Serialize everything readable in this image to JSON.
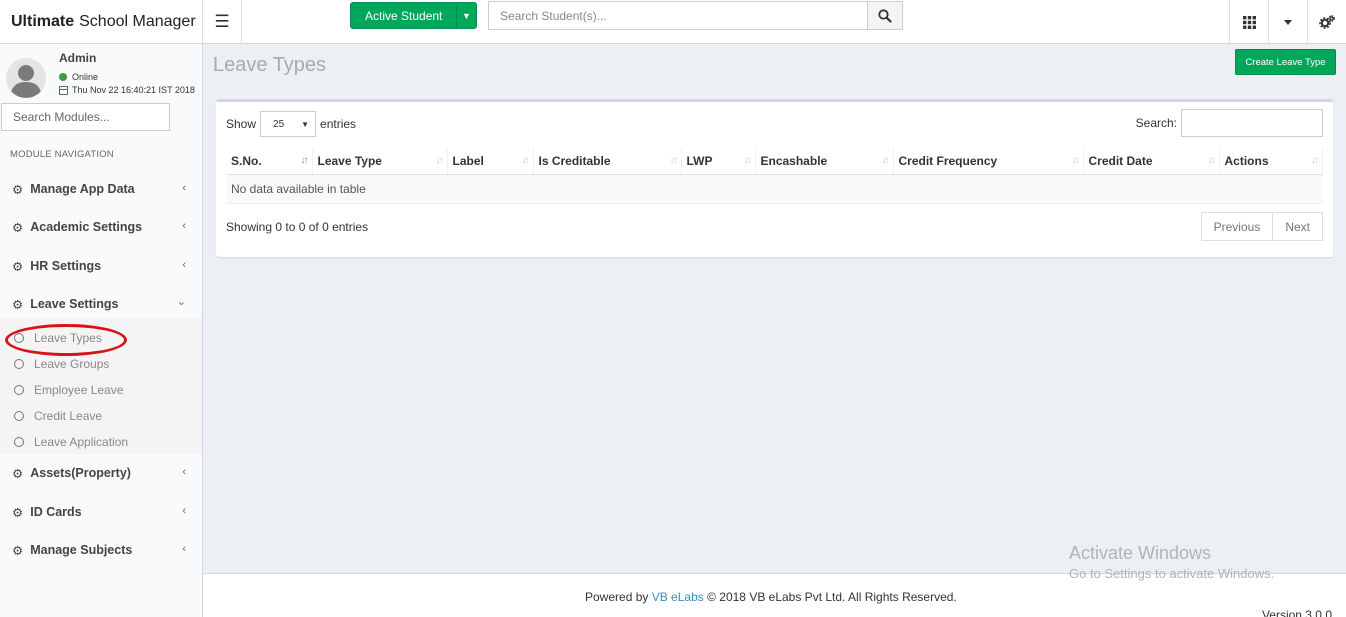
{
  "app": {
    "title_bold": "Ultimate",
    "title_rest": "School Manager"
  },
  "topbar": {
    "active_student_label": "Active Student",
    "student_search_placeholder": "Search Student(s)..."
  },
  "sidebar": {
    "user": {
      "name": "Admin",
      "status": "Online",
      "datetime": "Thu Nov 22 16:40:21 IST 2018"
    },
    "module_search_placeholder": "Search Modules...",
    "nav_header": "MODULE NAVIGATION",
    "items": [
      {
        "label": "Manage App Data"
      },
      {
        "label": "Academic Settings"
      },
      {
        "label": "HR Settings"
      },
      {
        "label": "Leave Settings"
      },
      {
        "label": "Assets(Property)"
      },
      {
        "label": "ID Cards"
      },
      {
        "label": "Manage Subjects"
      }
    ],
    "leave_subitems": [
      {
        "label": "Leave Types"
      },
      {
        "label": "Leave Groups"
      },
      {
        "label": "Employee Leave"
      },
      {
        "label": "Credit Leave"
      },
      {
        "label": "Leave Application"
      }
    ]
  },
  "main": {
    "page_title": "Leave Types",
    "create_button": "Create Leave Type",
    "table": {
      "show_label": "Show",
      "entries_value": "25",
      "entries_label": "entries",
      "search_label": "Search:",
      "columns": [
        "S.No.",
        "Leave Type",
        "Label",
        "Is Creditable",
        "LWP",
        "Encashable",
        "Credit Frequency",
        "Credit Date",
        "Actions"
      ],
      "empty_message": "No data available in table",
      "info": "Showing 0 to 0 of 0 entries",
      "pagination": {
        "previous": "Previous",
        "next": "Next"
      }
    }
  },
  "footer": {
    "powered_by": "Powered by",
    "company_link": "VB eLabs",
    "copyright": "© 2018 VB eLabs Pvt Ltd. All Rights Reserved.",
    "version": "Version 3.0.0"
  },
  "watermark": {
    "line1": "Activate Windows",
    "line2": "Go to Settings to activate Windows."
  },
  "colors": {
    "accent_green": "#00a65a",
    "link_blue": "#3c8dbc",
    "highlight_red": "#d8121a"
  }
}
